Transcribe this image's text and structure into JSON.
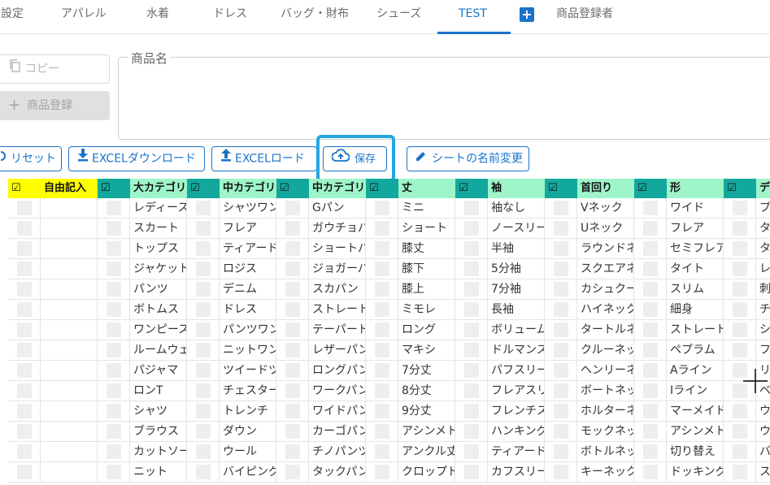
{
  "tabs": [
    {
      "label": "設定"
    },
    {
      "label": "アパレル"
    },
    {
      "label": "水着"
    },
    {
      "label": "ドレス"
    },
    {
      "label": "バッグ・財布"
    },
    {
      "label": "シューズ"
    },
    {
      "label": "TEST"
    },
    {
      "label": "商品登録者"
    }
  ],
  "add_tab_label": "+",
  "buttons": {
    "copy": "コピー",
    "register": "商品登録",
    "reset": "リセット",
    "excel_download": "EXCELダウンロード",
    "excel_load": "EXCELロード",
    "save": "保存",
    "rename_sheet": "シートの名前変更"
  },
  "product_name_label": "商品名",
  "colors": {
    "accent": "#1a73c8",
    "focus": "#22a7e0",
    "header_yellow": "#ffff00",
    "header_green": "#9ef5c9",
    "header_teal": "#13a89e"
  },
  "table": {
    "headers": [
      "☑",
      "自由記入",
      "☑",
      "大カテゴリ",
      "☑",
      "中カテゴリ",
      "☑",
      "中カテゴリ",
      "☑",
      "丈",
      "☑",
      "袖",
      "☑",
      "首回り",
      "☑",
      "形",
      "☑",
      "デ"
    ],
    "rows": [
      [
        "レディース",
        "シャツワン",
        "Gパン",
        "ミニ",
        "袖なし",
        "Vネック",
        "ワイド",
        "プ"
      ],
      [
        "スカート",
        "フレア",
        "ガウチョパ",
        "ショート",
        "ノースリー",
        "Uネック",
        "フレア",
        "タ"
      ],
      [
        "トップス",
        "ティアード",
        "ショートパ",
        "膝丈",
        "半袖",
        "ラウンドネ",
        "セミフレア",
        "タ"
      ],
      [
        "ジャケット",
        "ロジス",
        "ジョガーパ",
        "膝下",
        "5分袖",
        "スクエアネ",
        "タイト",
        "レ"
      ],
      [
        "パンツ",
        "デニム",
        "スカパン",
        "膝上",
        "7分袖",
        "カシュクー",
        "スリム",
        "刺"
      ],
      [
        "ボトムス",
        "ドレス",
        "ストレート",
        "ミモレ",
        "長袖",
        "ハイネック",
        "細身",
        "チ"
      ],
      [
        "ワンピース",
        "パンツワン",
        "テーパード",
        "ロング",
        "ボリューム",
        "タートルネ",
        "ストレート",
        "シ"
      ],
      [
        "ルームウェ",
        "ニットワン",
        "レザーパン",
        "マキシ",
        "ドルマンス",
        "クルーネッ",
        "ペプラム",
        "フ"
      ],
      [
        "パジャマ",
        "ツイードツ",
        "ロングパン",
        "7分丈",
        "パフスリー",
        "ヘンリーネ",
        "Aライン",
        "リ"
      ],
      [
        "ロンT",
        "チェスター",
        "ワークパン",
        "8分丈",
        "フレアスリ",
        "ボートネッ",
        "Iライン",
        "ベ"
      ],
      [
        "シャツ",
        "トレンチ",
        "ワイドパン",
        "9分丈",
        "フレンチス",
        "ホルターネ",
        "マーメイド",
        "ウ"
      ],
      [
        "ブラウス",
        "ダウン",
        "カーゴパン",
        "アシンメト",
        "ハンキング",
        "モックネッ",
        "アシンメト",
        "ウ"
      ],
      [
        "カットソー",
        "ウール",
        "チノパンツ",
        "アンクル丈",
        "ティアード",
        "ボトルネッ",
        "切り替え",
        "バ"
      ],
      [
        "ニット",
        "バイピング",
        "タックパン",
        "クロップド",
        "カフスリー",
        "キーネック",
        "ドッキング",
        "ス"
      ]
    ]
  }
}
